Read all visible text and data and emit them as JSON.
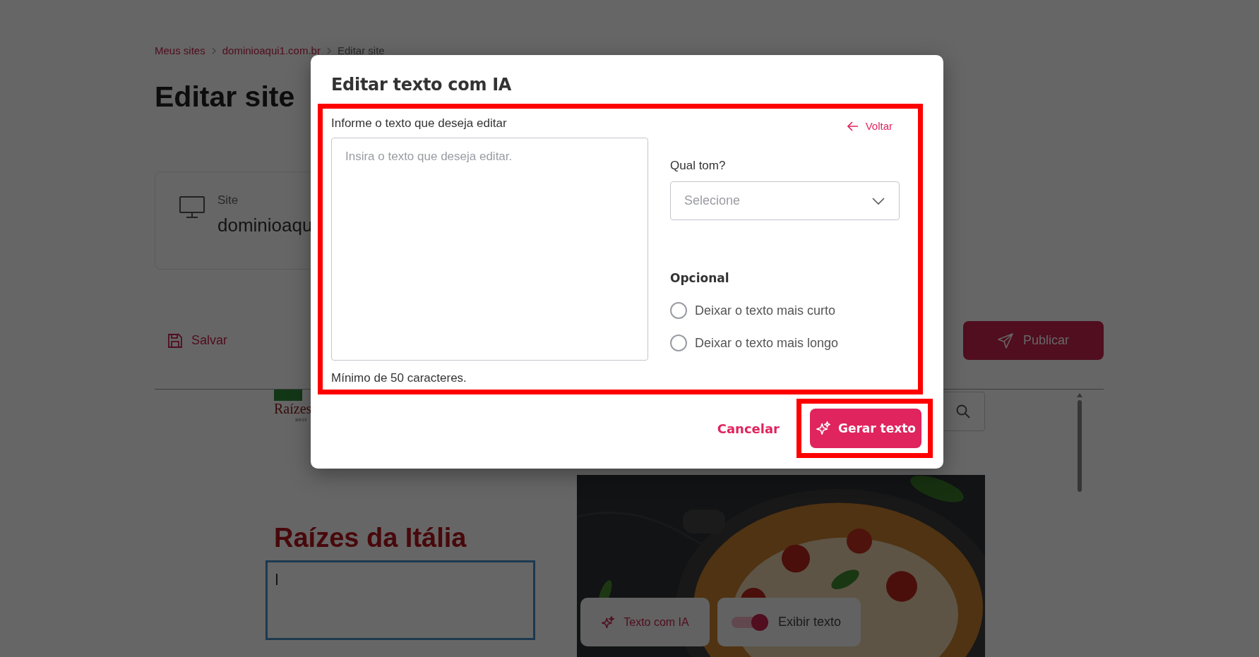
{
  "page": {
    "breadcrumbs": [
      {
        "label": "Meus sites",
        "current": false
      },
      {
        "label": "dominioaqui1.com.br",
        "current": false
      },
      {
        "label": "Editar site",
        "current": true
      }
    ],
    "title": "Editar site",
    "site_card": {
      "label": "Site",
      "value": "dominioaqu"
    },
    "save_button": "Salvar",
    "publish_button": "Publicar",
    "preview": {
      "logo_text": "Raízes",
      "logo_subtext": "REST",
      "heading": "Raízes da Itália",
      "ai_button": "Texto com IA",
      "show_text_toggle": {
        "label": "Exibir texto",
        "on": true
      }
    }
  },
  "modal": {
    "title": "Editar texto com IA",
    "text_label": "Informe o texto que deseja editar",
    "textarea": {
      "placeholder": "Insira o texto que deseja editar."
    },
    "hint": "Mínimo de 50 caracteres.",
    "back_link": "Voltar",
    "tone": {
      "label": "Qual tom?",
      "placeholder": "Selecione"
    },
    "optional": {
      "label": "Opcional",
      "options": [
        {
          "label": "Deixar o texto mais curto",
          "selected": false
        },
        {
          "label": "Deixar o texto mais longo",
          "selected": false
        }
      ]
    },
    "cancel_button": "Cancelar",
    "generate_button": "Gerar texto"
  }
}
